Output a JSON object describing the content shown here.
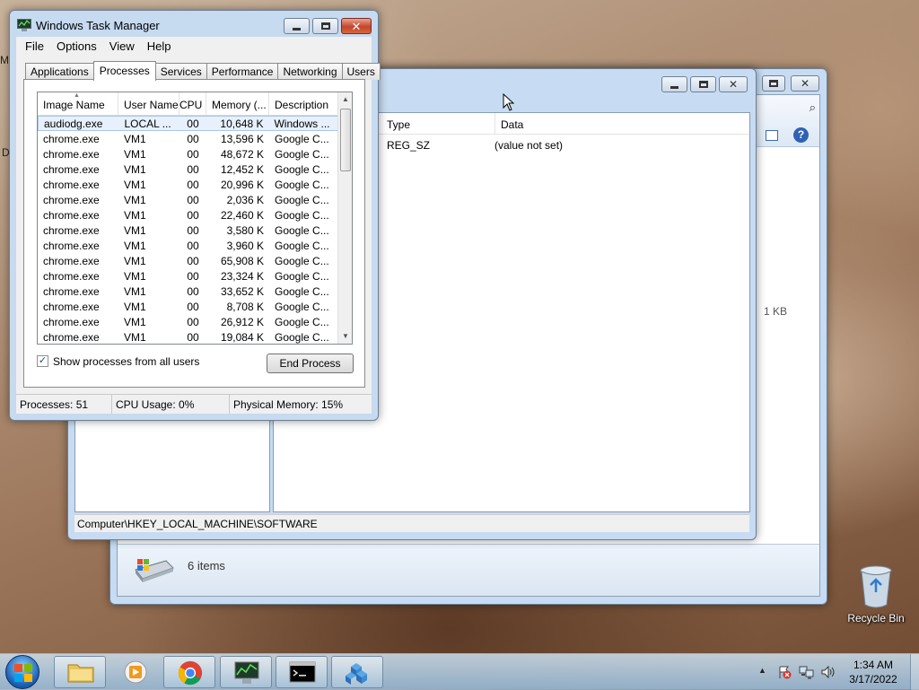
{
  "desktop": {
    "recycle_bin_label": "Recycle Bin",
    "left_edge_letters": [
      "M",
      "D"
    ]
  },
  "explorer": {
    "status_text": "6 items",
    "size_text": "1 KB"
  },
  "regedit": {
    "columns": [
      "Type",
      "Data"
    ],
    "values": [
      {
        "type": "REG_SZ",
        "data": "(value not set)"
      }
    ],
    "status_path": "Computer\\HKEY_LOCAL_MACHINE\\SOFTWARE"
  },
  "taskmgr": {
    "title": "Windows Task Manager",
    "menu": [
      "File",
      "Options",
      "View",
      "Help"
    ],
    "tabs": [
      "Applications",
      "Processes",
      "Services",
      "Performance",
      "Networking",
      "Users"
    ],
    "active_tab": "Processes",
    "columns": [
      "Image Name",
      "User Name",
      "CPU",
      "Memory (...",
      "Description"
    ],
    "rows": [
      {
        "name": "audiodg.exe",
        "user": "LOCAL ...",
        "cpu": "00",
        "mem": "10,648 K",
        "desc": "Windows ..."
      },
      {
        "name": "chrome.exe",
        "user": "VM1",
        "cpu": "00",
        "mem": "13,596 K",
        "desc": "Google C..."
      },
      {
        "name": "chrome.exe",
        "user": "VM1",
        "cpu": "00",
        "mem": "48,672 K",
        "desc": "Google C..."
      },
      {
        "name": "chrome.exe",
        "user": "VM1",
        "cpu": "00",
        "mem": "12,452 K",
        "desc": "Google C..."
      },
      {
        "name": "chrome.exe",
        "user": "VM1",
        "cpu": "00",
        "mem": "20,996 K",
        "desc": "Google C..."
      },
      {
        "name": "chrome.exe",
        "user": "VM1",
        "cpu": "00",
        "mem": "2,036 K",
        "desc": "Google C..."
      },
      {
        "name": "chrome.exe",
        "user": "VM1",
        "cpu": "00",
        "mem": "22,460 K",
        "desc": "Google C..."
      },
      {
        "name": "chrome.exe",
        "user": "VM1",
        "cpu": "00",
        "mem": "3,580 K",
        "desc": "Google C..."
      },
      {
        "name": "chrome.exe",
        "user": "VM1",
        "cpu": "00",
        "mem": "3,960 K",
        "desc": "Google C..."
      },
      {
        "name": "chrome.exe",
        "user": "VM1",
        "cpu": "00",
        "mem": "65,908 K",
        "desc": "Google C..."
      },
      {
        "name": "chrome.exe",
        "user": "VM1",
        "cpu": "00",
        "mem": "23,324 K",
        "desc": "Google C..."
      },
      {
        "name": "chrome.exe",
        "user": "VM1",
        "cpu": "00",
        "mem": "33,652 K",
        "desc": "Google C..."
      },
      {
        "name": "chrome.exe",
        "user": "VM1",
        "cpu": "00",
        "mem": "8,708 K",
        "desc": "Google C..."
      },
      {
        "name": "chrome.exe",
        "user": "VM1",
        "cpu": "00",
        "mem": "26,912 K",
        "desc": "Google C..."
      },
      {
        "name": "chrome.exe",
        "user": "VM1",
        "cpu": "00",
        "mem": "19,084 K",
        "desc": "Google C..."
      }
    ],
    "show_all_label": "Show processes from all users",
    "show_all_checked": true,
    "end_process_label": "End Process",
    "status": {
      "processes": "Processes: 51",
      "cpu": "CPU Usage: 0%",
      "memory": "Physical Memory: 15%"
    }
  },
  "taskbar": {
    "pinned": [
      "start-orb-icon",
      "windows-explorer-icon",
      "media-player-icon",
      "chrome-icon",
      "task-manager-icon",
      "command-prompt-icon",
      "registry-editor-icon"
    ],
    "time": "1:34 AM",
    "date": "3/17/2022"
  },
  "colors": {
    "selection": "#e7f0fb",
    "window_frame": "#c6daf0",
    "close_button": "#c4452c"
  }
}
